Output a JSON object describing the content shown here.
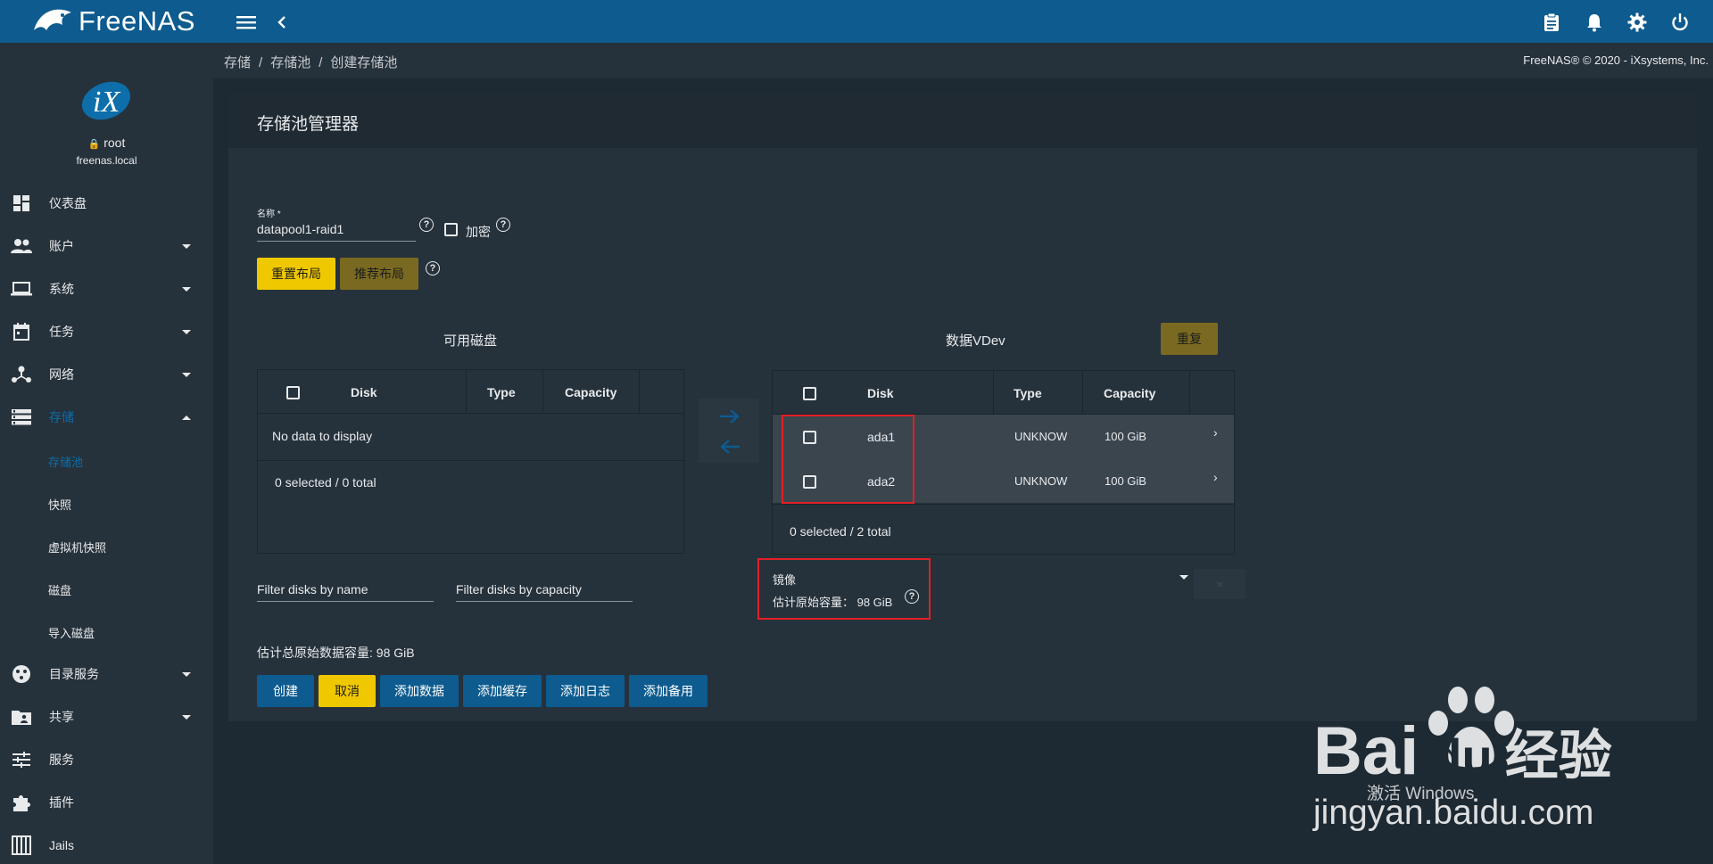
{
  "app": {
    "name": "FreeNAS",
    "copyright": "FreeNAS® © 2020 - iXsystems, Inc."
  },
  "user": {
    "name": "root",
    "host": "freenas.local"
  },
  "nav": {
    "items": [
      {
        "label": "仪表盘",
        "icon": "dashboard-icon"
      },
      {
        "label": "账户",
        "icon": "accounts-icon"
      },
      {
        "label": "系统",
        "icon": "system-icon"
      },
      {
        "label": "任务",
        "icon": "tasks-icon"
      },
      {
        "label": "网络",
        "icon": "network-icon"
      },
      {
        "label": "存储",
        "icon": "storage-icon"
      },
      {
        "label": "目录服务",
        "icon": "directory-services-icon"
      },
      {
        "label": "共享",
        "icon": "sharing-icon"
      },
      {
        "label": "服务",
        "icon": "services-icon"
      },
      {
        "label": "插件",
        "icon": "plugins-icon"
      },
      {
        "label": "Jails",
        "icon": "jails-icon"
      }
    ],
    "storage_sub": [
      "存储池",
      "快照",
      "虚拟机快照",
      "磁盘",
      "导入磁盘"
    ]
  },
  "breadcrumb": [
    "存储",
    "存储池",
    "创建存储池"
  ],
  "card": {
    "title": "存储池管理器"
  },
  "form": {
    "name_label": "名称 *",
    "name_value": "datapool1-raid1",
    "encrypt_label": "加密",
    "reset_layout": "重置布局",
    "suggest_layout": "推荐布局"
  },
  "available": {
    "title": "可用磁盘",
    "columns": [
      "Disk",
      "Type",
      "Capacity"
    ],
    "empty": "No data to display",
    "footer": "0 selected / 0 total",
    "filter_name": "Filter disks by name",
    "filter_capacity": "Filter disks by capacity"
  },
  "vdev": {
    "title": "数据VDev",
    "repeat": "重复",
    "columns": [
      "Disk",
      "Type",
      "Capacity"
    ],
    "rows": [
      {
        "disk": "ada1",
        "type": "UNKNOW",
        "capacity": "100 GiB"
      },
      {
        "disk": "ada2",
        "type": "UNKNOW",
        "capacity": "100 GiB"
      }
    ],
    "footer": "0 selected / 2 total",
    "layout": "镜像",
    "raw_capacity": "估计原始容量： 98 GiB"
  },
  "summary": "估计总原始数据容量: 98 GiB",
  "actions": [
    "创建",
    "取消",
    "添加数据",
    "添加缓存",
    "添加日志",
    "添加备用"
  ],
  "watermark": {
    "brand_a": "Bai",
    "brand_b": "du",
    "brand_c": "经验",
    "url": "jingyan.baidu.com",
    "activate": "激活 Windows"
  }
}
